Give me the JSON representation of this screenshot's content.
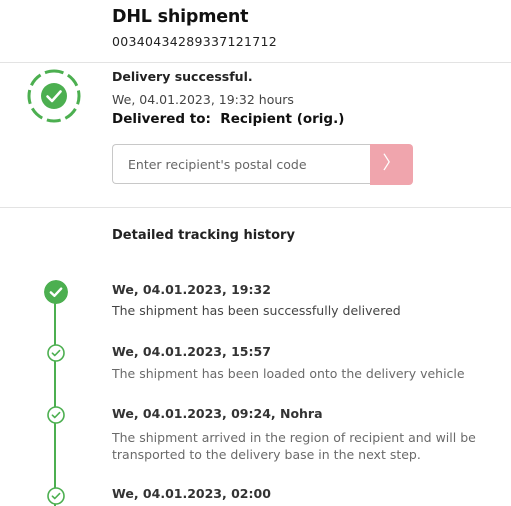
{
  "shipment": {
    "title": "DHL shipment",
    "tracking_number": "00340434289337121712"
  },
  "status": {
    "icon": "check-circle-icon",
    "title": "Delivery successful.",
    "timestamp": "We, 04.01.2023, 19:32 hours",
    "delivered_to_label": "Delivered to:",
    "delivered_to_value": "Recipient (orig.)"
  },
  "postal_code": {
    "placeholder": "Enter recipient's postal code",
    "value": "",
    "submit_icon": "chevron-right-icon"
  },
  "history": {
    "heading": "Detailed tracking history",
    "events": [
      {
        "date": "We, 04.01.2023, 19:32",
        "description": "The shipment has been successfully delivered"
      },
      {
        "date": "We, 04.01.2023, 15:57",
        "description": "The shipment has been loaded onto the delivery vehicle"
      },
      {
        "date": "We, 04.01.2023, 09:24, Nohra",
        "description": "The shipment arrived in the region of recipient and will be transported to the delivery base in the next step."
      },
      {
        "date": "We, 04.01.2023, 02:00",
        "description": ""
      }
    ]
  },
  "colors": {
    "success_green": "#4caf50",
    "submit_button_pink": "#f0a5ad",
    "divider": "#e3e3e3"
  }
}
